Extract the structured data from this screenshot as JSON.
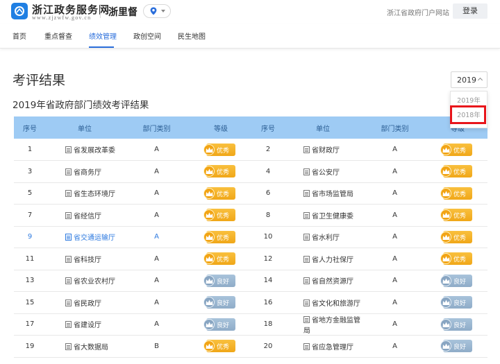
{
  "header": {
    "site_name": "浙江政务服务网",
    "site_url": "www.zjzwfw.gov.cn",
    "brand": "浙里督",
    "portal_link": "浙江省政府门户网站",
    "login": "登录"
  },
  "nav": [
    "首页",
    "重点督查",
    "绩效管理",
    "政创空间",
    "民生地图"
  ],
  "nav_active": "绩效管理",
  "page": {
    "title": "考评结果",
    "subtitle": "2019年省政府部门绩效考评结果"
  },
  "year_select": {
    "value": "2019",
    "options": [
      "2019年",
      "2018年"
    ],
    "highlighted_option": "2018年"
  },
  "table": {
    "headers": [
      "序号",
      "单位",
      "部门类别",
      "等级",
      "序号",
      "单位",
      "部门类别",
      "等级"
    ],
    "rows": [
      {
        "n1": "1",
        "u1": "省发展改革委",
        "c1": "A",
        "g1": "优秀",
        "n2": "2",
        "u2": "省财政厅",
        "c2": "A",
        "g2": "优秀"
      },
      {
        "n1": "3",
        "u1": "省商务厅",
        "c1": "A",
        "g1": "优秀",
        "n2": "4",
        "u2": "省公安厅",
        "c2": "A",
        "g2": "优秀"
      },
      {
        "n1": "5",
        "u1": "省生态环境厅",
        "c1": "A",
        "g1": "优秀",
        "n2": "6",
        "u2": "省市场监管局",
        "c2": "A",
        "g2": "优秀"
      },
      {
        "n1": "7",
        "u1": "省经信厅",
        "c1": "A",
        "g1": "优秀",
        "n2": "8",
        "u2": "省卫生健康委",
        "c2": "A",
        "g2": "优秀"
      },
      {
        "n1": "9",
        "u1": "省交通运输厅",
        "c1": "A",
        "g1": "优秀",
        "n2": "10",
        "u2": "省水利厅",
        "c2": "A",
        "g2": "优秀"
      },
      {
        "n1": "11",
        "u1": "省科技厅",
        "c1": "A",
        "g1": "优秀",
        "n2": "12",
        "u2": "省人力社保厅",
        "c2": "A",
        "g2": "优秀"
      },
      {
        "n1": "13",
        "u1": "省农业农村厅",
        "c1": "A",
        "g1": "良好",
        "n2": "14",
        "u2": "省自然资源厅",
        "c2": "A",
        "g2": "良好"
      },
      {
        "n1": "15",
        "u1": "省民政厅",
        "c1": "A",
        "g1": "良好",
        "n2": "16",
        "u2": "省文化和旅游厅",
        "c2": "A",
        "g2": "良好"
      },
      {
        "n1": "17",
        "u1": "省建设厅",
        "c1": "A",
        "g1": "良好",
        "n2": "18",
        "u2": "省地方金融监管局",
        "c2": "A",
        "g2": "良好"
      },
      {
        "n1": "19",
        "u1": "省大数据局",
        "c1": "B",
        "g1": "优秀",
        "n2": "20",
        "u2": "省应急管理厅",
        "c2": "A",
        "g2": "良好"
      }
    ]
  },
  "colors": {
    "accent": "#2a6edb",
    "table_header_bg": "#9ecbf4",
    "badge_excellent": "#f0a718",
    "badge_good": "#8facc8",
    "highlight": "#e8141a"
  }
}
